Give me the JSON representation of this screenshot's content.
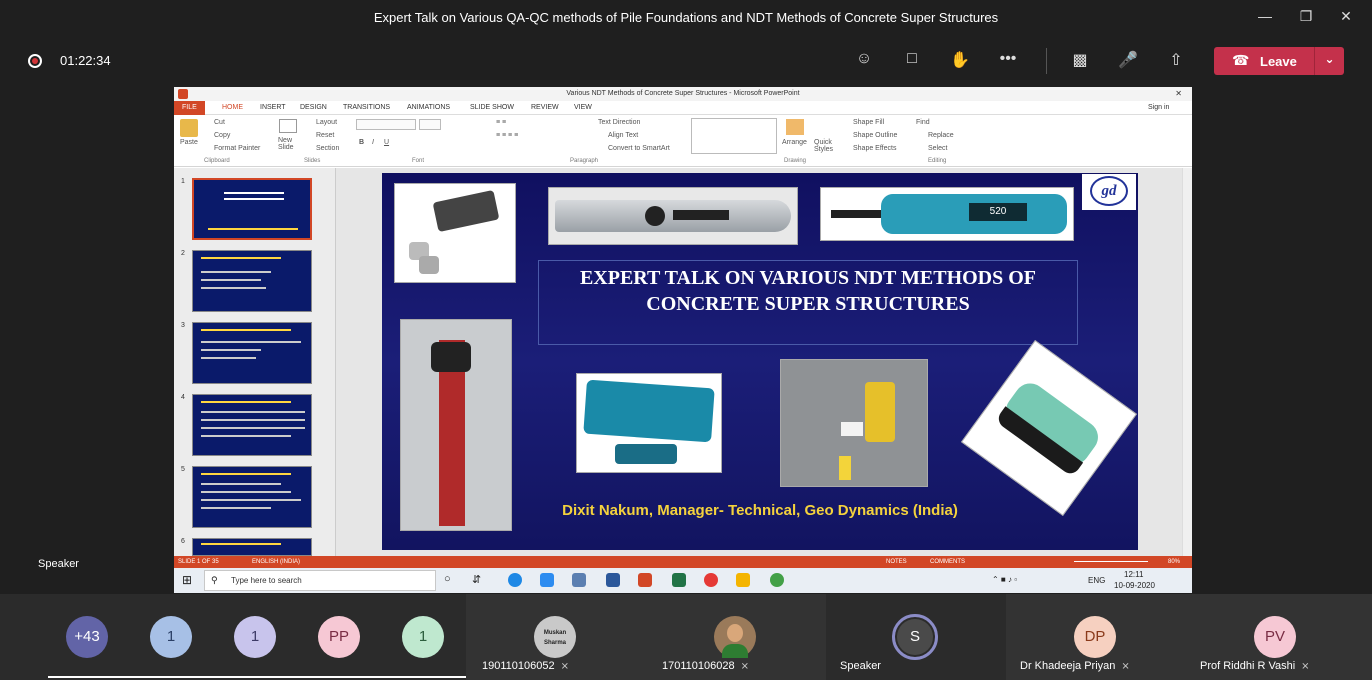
{
  "window": {
    "title": "Expert Talk on Various QA-QC methods of Pile Foundations and NDT Methods of Concrete Super Structures"
  },
  "meeting": {
    "timer": "01:22:34",
    "leave_label": "Leave"
  },
  "powerpoint": {
    "title": "Various NDT Methods of Concrete Super Structures - Microsoft PowerPoint",
    "sign_in": "Sign in",
    "tabs": [
      "FILE",
      "HOME",
      "INSERT",
      "DESIGN",
      "TRANSITIONS",
      "ANIMATIONS",
      "SLIDE SHOW",
      "REVIEW",
      "VIEW"
    ],
    "ribbon": {
      "paste": "Paste",
      "cut": "Cut",
      "copy": "Copy",
      "format_painter": "Format Painter",
      "clipboard": "Clipboard",
      "new_slide": "New Slide",
      "layout": "Layout",
      "reset": "Reset",
      "section": "Section",
      "slides": "Slides",
      "font": "Font",
      "text_direction": "Text Direction",
      "align_text": "Align Text",
      "convert_smartart": "Convert to SmartArt",
      "paragraph": "Paragraph",
      "arrange": "Arrange",
      "quick_styles": "Quick Styles",
      "shape_fill": "Shape Fill",
      "shape_outline": "Shape Outline",
      "shape_effects": "Shape Effects",
      "drawing": "Drawing",
      "find": "Find",
      "replace": "Replace",
      "select": "Select",
      "editing": "Editing"
    },
    "thumb_numbers": [
      "1",
      "2",
      "3",
      "4",
      "5",
      "6"
    ],
    "slide": {
      "title": "EXPERT TALK ON VARIOUS NDT METHODS OF CONCRETE SUPER STRUCTURES",
      "presenter": "Dixit Nakum, Manager- Technical, Geo Dynamics (India)",
      "logo": "gd",
      "device_readout": "520"
    },
    "status": {
      "slide": "SLIDE 1 OF 35",
      "lang": "ENGLISH (INDIA)",
      "notes": "NOTES",
      "comments": "COMMENTS",
      "zoom": "80%"
    },
    "taskbar": {
      "search_placeholder": "Type here to search",
      "lang": "ENG",
      "time": "12:11",
      "date": "10-09-2020"
    }
  },
  "speaker_label": "Speaker",
  "roster": {
    "overflow": "+43",
    "avatars": [
      {
        "initials": "1",
        "bg": "#a7c0e6",
        "fg": "#2b3f66"
      },
      {
        "initials": "1",
        "bg": "#c8c4ec",
        "fg": "#3d3a66"
      },
      {
        "initials": "PP",
        "bg": "#f6c8d4",
        "fg": "#7a2d44"
      },
      {
        "initials": "1",
        "bg": "#bfe8cf",
        "fg": "#2c5e3d"
      }
    ],
    "participants": [
      {
        "name": "190110106052",
        "photo_text": "Muskan Sharma"
      },
      {
        "name": "170110106028"
      },
      {
        "name": "Speaker",
        "initials": "S"
      },
      {
        "name": "Dr Khadeeja Priyan",
        "initials": "DP"
      },
      {
        "name": "Prof Riddhi R Vashi",
        "initials": "PV"
      }
    ]
  }
}
